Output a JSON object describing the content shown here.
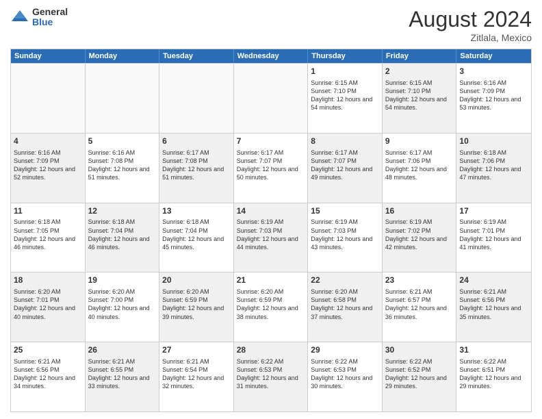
{
  "logo": {
    "general": "General",
    "blue": "Blue"
  },
  "title": "August 2024",
  "location": "Zitlala, Mexico",
  "days": [
    "Sunday",
    "Monday",
    "Tuesday",
    "Wednesday",
    "Thursday",
    "Friday",
    "Saturday"
  ],
  "weeks": [
    [
      {
        "day": "",
        "text": "",
        "empty": true
      },
      {
        "day": "",
        "text": "",
        "empty": true
      },
      {
        "day": "",
        "text": "",
        "empty": true
      },
      {
        "day": "",
        "text": "",
        "empty": true
      },
      {
        "day": "1",
        "text": "Sunrise: 6:15 AM\nSunset: 7:10 PM\nDaylight: 12 hours\nand 54 minutes.",
        "shaded": false
      },
      {
        "day": "2",
        "text": "Sunrise: 6:15 AM\nSunset: 7:10 PM\nDaylight: 12 hours\nand 54 minutes.",
        "shaded": true
      },
      {
        "day": "3",
        "text": "Sunrise: 6:16 AM\nSunset: 7:09 PM\nDaylight: 12 hours\nand 53 minutes.",
        "shaded": false
      }
    ],
    [
      {
        "day": "4",
        "text": "Sunrise: 6:16 AM\nSunset: 7:09 PM\nDaylight: 12 hours\nand 52 minutes.",
        "shaded": true
      },
      {
        "day": "5",
        "text": "Sunrise: 6:16 AM\nSunset: 7:08 PM\nDaylight: 12 hours\nand 51 minutes.",
        "shaded": false
      },
      {
        "day": "6",
        "text": "Sunrise: 6:17 AM\nSunset: 7:08 PM\nDaylight: 12 hours\nand 51 minutes.",
        "shaded": true
      },
      {
        "day": "7",
        "text": "Sunrise: 6:17 AM\nSunset: 7:07 PM\nDaylight: 12 hours\nand 50 minutes.",
        "shaded": false
      },
      {
        "day": "8",
        "text": "Sunrise: 6:17 AM\nSunset: 7:07 PM\nDaylight: 12 hours\nand 49 minutes.",
        "shaded": true
      },
      {
        "day": "9",
        "text": "Sunrise: 6:17 AM\nSunset: 7:06 PM\nDaylight: 12 hours\nand 48 minutes.",
        "shaded": false
      },
      {
        "day": "10",
        "text": "Sunrise: 6:18 AM\nSunset: 7:06 PM\nDaylight: 12 hours\nand 47 minutes.",
        "shaded": true
      }
    ],
    [
      {
        "day": "11",
        "text": "Sunrise: 6:18 AM\nSunset: 7:05 PM\nDaylight: 12 hours\nand 46 minutes.",
        "shaded": false
      },
      {
        "day": "12",
        "text": "Sunrise: 6:18 AM\nSunset: 7:04 PM\nDaylight: 12 hours\nand 46 minutes.",
        "shaded": true
      },
      {
        "day": "13",
        "text": "Sunrise: 6:18 AM\nSunset: 7:04 PM\nDaylight: 12 hours\nand 45 minutes.",
        "shaded": false
      },
      {
        "day": "14",
        "text": "Sunrise: 6:19 AM\nSunset: 7:03 PM\nDaylight: 12 hours\nand 44 minutes.",
        "shaded": true
      },
      {
        "day": "15",
        "text": "Sunrise: 6:19 AM\nSunset: 7:03 PM\nDaylight: 12 hours\nand 43 minutes.",
        "shaded": false
      },
      {
        "day": "16",
        "text": "Sunrise: 6:19 AM\nSunset: 7:02 PM\nDaylight: 12 hours\nand 42 minutes.",
        "shaded": true
      },
      {
        "day": "17",
        "text": "Sunrise: 6:19 AM\nSunset: 7:01 PM\nDaylight: 12 hours\nand 41 minutes.",
        "shaded": false
      }
    ],
    [
      {
        "day": "18",
        "text": "Sunrise: 6:20 AM\nSunset: 7:01 PM\nDaylight: 12 hours\nand 40 minutes.",
        "shaded": true
      },
      {
        "day": "19",
        "text": "Sunrise: 6:20 AM\nSunset: 7:00 PM\nDaylight: 12 hours\nand 40 minutes.",
        "shaded": false
      },
      {
        "day": "20",
        "text": "Sunrise: 6:20 AM\nSunset: 6:59 PM\nDaylight: 12 hours\nand 39 minutes.",
        "shaded": true
      },
      {
        "day": "21",
        "text": "Sunrise: 6:20 AM\nSunset: 6:59 PM\nDaylight: 12 hours\nand 38 minutes.",
        "shaded": false
      },
      {
        "day": "22",
        "text": "Sunrise: 6:20 AM\nSunset: 6:58 PM\nDaylight: 12 hours\nand 37 minutes.",
        "shaded": true
      },
      {
        "day": "23",
        "text": "Sunrise: 6:21 AM\nSunset: 6:57 PM\nDaylight: 12 hours\nand 36 minutes.",
        "shaded": false
      },
      {
        "day": "24",
        "text": "Sunrise: 6:21 AM\nSunset: 6:56 PM\nDaylight: 12 hours\nand 35 minutes.",
        "shaded": true
      }
    ],
    [
      {
        "day": "25",
        "text": "Sunrise: 6:21 AM\nSunset: 6:56 PM\nDaylight: 12 hours\nand 34 minutes.",
        "shaded": false
      },
      {
        "day": "26",
        "text": "Sunrise: 6:21 AM\nSunset: 6:55 PM\nDaylight: 12 hours\nand 33 minutes.",
        "shaded": true
      },
      {
        "day": "27",
        "text": "Sunrise: 6:21 AM\nSunset: 6:54 PM\nDaylight: 12 hours\nand 32 minutes.",
        "shaded": false
      },
      {
        "day": "28",
        "text": "Sunrise: 6:22 AM\nSunset: 6:53 PM\nDaylight: 12 hours\nand 31 minutes.",
        "shaded": true
      },
      {
        "day": "29",
        "text": "Sunrise: 6:22 AM\nSunset: 6:53 PM\nDaylight: 12 hours\nand 30 minutes.",
        "shaded": false
      },
      {
        "day": "30",
        "text": "Sunrise: 6:22 AM\nSunset: 6:52 PM\nDaylight: 12 hours\nand 29 minutes.",
        "shaded": true
      },
      {
        "day": "31",
        "text": "Sunrise: 6:22 AM\nSunset: 6:51 PM\nDaylight: 12 hours\nand 29 minutes.",
        "shaded": false
      }
    ]
  ]
}
